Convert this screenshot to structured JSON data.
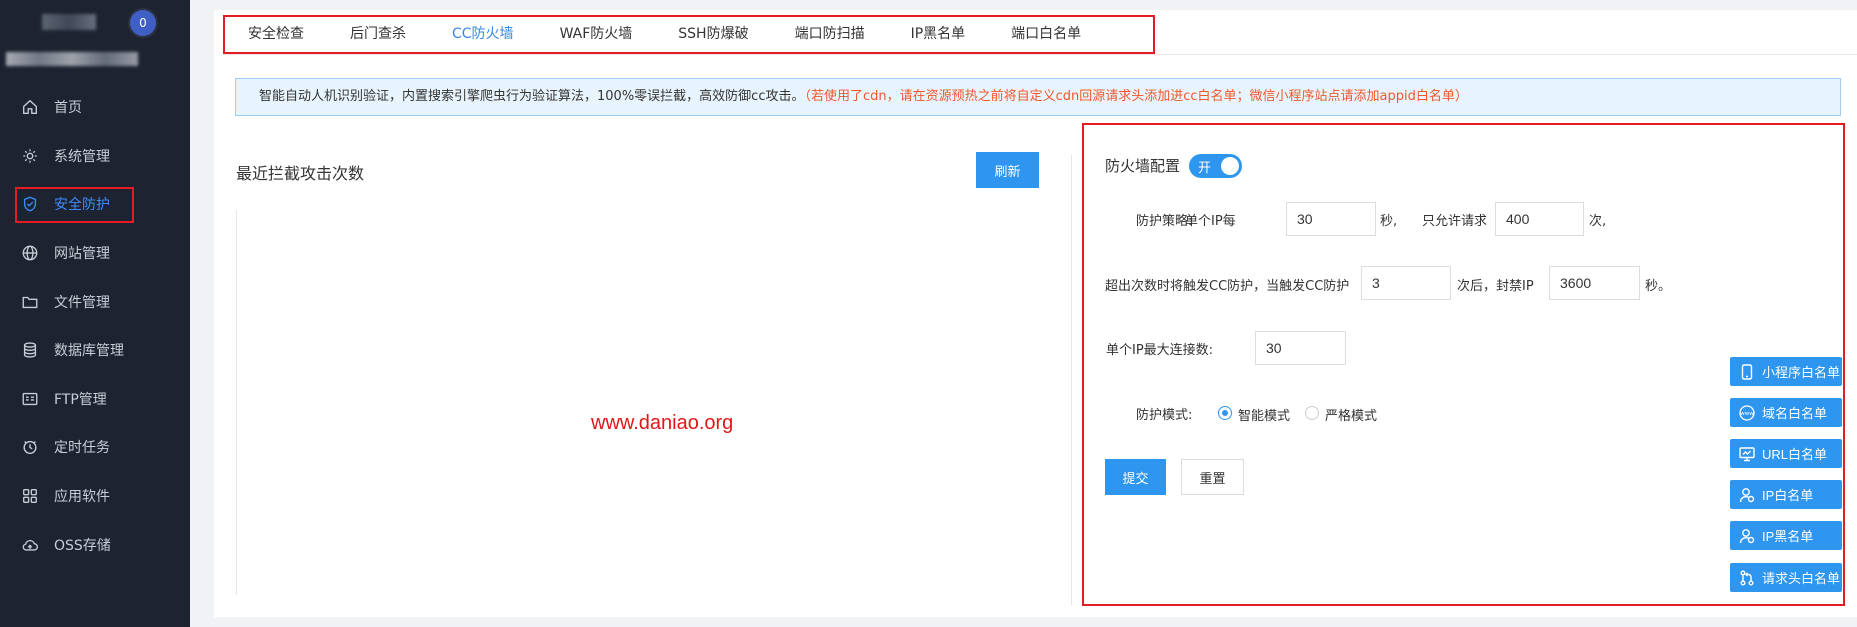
{
  "sidebar": {
    "notice_count": "0",
    "items": [
      {
        "label": "首页",
        "icon": "home-icon"
      },
      {
        "label": "系统管理",
        "icon": "gear-icon"
      },
      {
        "label": "安全防护",
        "icon": "shield-icon"
      },
      {
        "label": "网站管理",
        "icon": "globe-icon"
      },
      {
        "label": "文件管理",
        "icon": "folder-icon"
      },
      {
        "label": "数据库管理",
        "icon": "database-icon"
      },
      {
        "label": "FTP管理",
        "icon": "ftp-icon"
      },
      {
        "label": "定时任务",
        "icon": "clock-icon"
      },
      {
        "label": "应用软件",
        "icon": "apps-icon"
      },
      {
        "label": "OSS存储",
        "icon": "cloud-icon"
      }
    ],
    "active_index": 2
  },
  "tabs": [
    "安全检查",
    "后门查杀",
    "CC防火墙",
    "WAF防火墙",
    "SSH防爆破",
    "端口防扫描",
    "IP黑名单",
    "端口白名单"
  ],
  "active_tab": 2,
  "alert": {
    "text": "智能自动人机识别验证，内置搜索引擎爬虫行为验证算法，100%零误拦截，高效防御cc攻击。",
    "warning": "（若使用了cdn，请在资源预热之前将自定义cdn回源请求头添加进cc白名单；微信小程序站点请添加appid白名单）"
  },
  "chart": {
    "title": "最近拦截攻击次数",
    "refresh_label": "刷新",
    "watermark": "www.daniao.org"
  },
  "config": {
    "title": "防火墙配置",
    "toggle_label": "开",
    "toggle_on": true,
    "policy_label": "防护策略:",
    "per_ip_label": "单个IP每",
    "interval_value": "30",
    "seconds_unit": "秒,",
    "allow_label": "只允许请求",
    "allow_value": "400",
    "times_unit": "次,",
    "trigger_label": "超出次数时将触发CC防护，当触发CC防护",
    "trigger_value": "3",
    "ban_label": "次后，封禁IP",
    "ban_value": "3600",
    "ban_unit": "秒。",
    "maxconn_label": "单个IP最大连接数:",
    "maxconn_value": "30",
    "mode_label": "防护模式:",
    "mode_smart": "智能模式",
    "mode_strict": "严格模式",
    "mode_selected": "smart",
    "submit_label": "提交",
    "reset_label": "重置"
  },
  "whitelist_buttons": [
    {
      "label": "小程序白名单",
      "icon": "phone-icon"
    },
    {
      "label": "域名白名单",
      "icon": "www-icon"
    },
    {
      "label": "URL白名单",
      "icon": "monitor-icon"
    },
    {
      "label": "IP白名单",
      "icon": "user-icon"
    },
    {
      "label": "IP黑名单",
      "icon": "user-icon"
    },
    {
      "label": "请求头白名单",
      "icon": "request-icon"
    }
  ],
  "colors": {
    "sidebar_bg": "#1d2330",
    "accent": "#2f96f0",
    "highlight_border": "#e51c23",
    "warning_text": "#f0582b"
  }
}
